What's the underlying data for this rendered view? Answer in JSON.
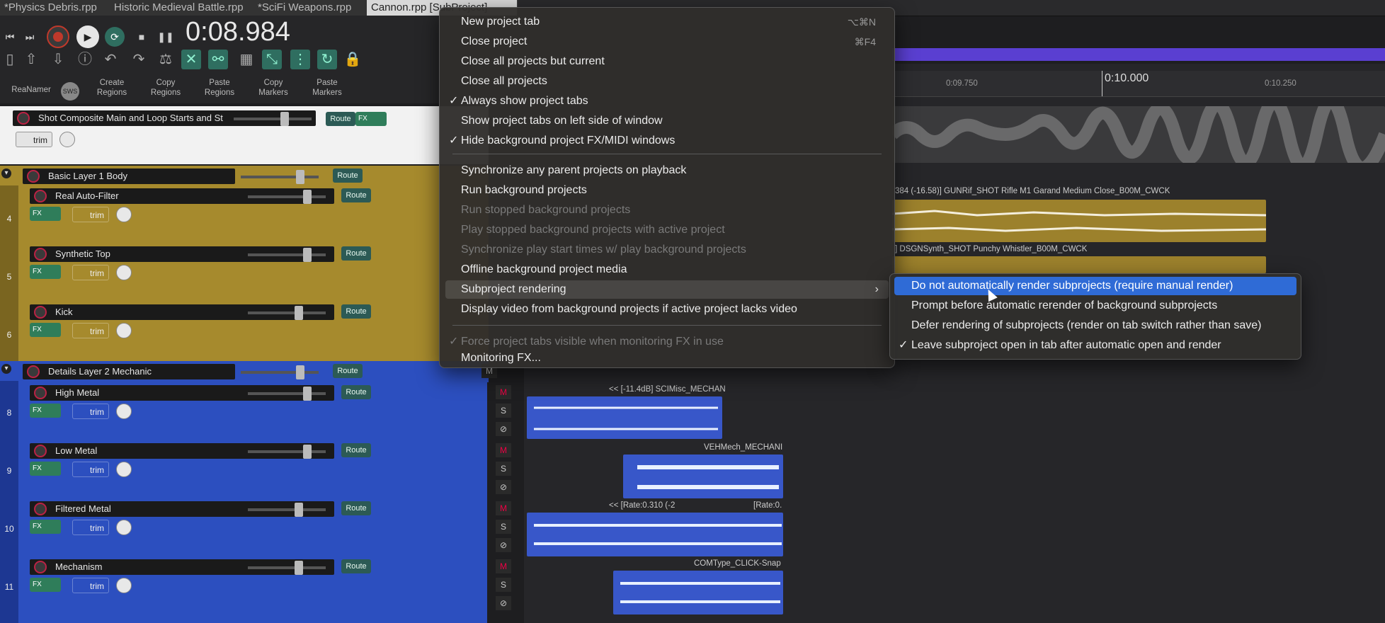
{
  "tabs": [
    "*Physics Debris.rpp",
    "Historic Medieval Battle.rpp",
    "*SciFi Weapons.rpp",
    "Cannon.rpp [SubProject]"
  ],
  "transport": {
    "timecode": "0:08.984"
  },
  "toolbar": {
    "labels": [
      "ReaNamer",
      "Create\nRegions",
      "Copy\nRegions",
      "Paste\nRegions",
      "Copy\nMarkers",
      "Paste\nMarkers"
    ],
    "badge": "SWS"
  },
  "tracks": [
    {
      "num": "",
      "name": "Shot Composite Main and Loop Starts and St",
      "color": "#ffffff",
      "route": "Route",
      "fx": "FX",
      "trim": "trim"
    },
    {
      "num": "",
      "name": "Basic Layer 1 Body",
      "color": "#a68a2d",
      "route": "Route"
    },
    {
      "num": "4",
      "name": "Real Auto-Filter",
      "color": "#a68a2d",
      "route": "Route",
      "fx": "FX",
      "trim": "trim"
    },
    {
      "num": "5",
      "name": "Synthetic Top",
      "color": "#a68a2d",
      "route": "Route",
      "fx": "FX",
      "trim": "trim"
    },
    {
      "num": "6",
      "name": "Kick",
      "color": "#a68a2d",
      "route": "Route",
      "fx": "FX",
      "trim": "trim"
    },
    {
      "num": "",
      "name": "Details Layer 2 Mechanic",
      "color": "#2c4fbf",
      "route": "Route"
    },
    {
      "num": "8",
      "name": "High Metal",
      "color": "#2c4fbf",
      "route": "Route",
      "fx": "FX",
      "trim": "trim"
    },
    {
      "num": "9",
      "name": "Low Metal",
      "color": "#2c4fbf",
      "route": "Route",
      "fx": "FX",
      "trim": "trim"
    },
    {
      "num": "10",
      "name": "Filtered Metal",
      "color": "#2c4fbf",
      "route": "Route",
      "fx": "FX",
      "trim": "trim"
    },
    {
      "num": "11",
      "name": "Mechanism",
      "color": "#2c4fbf",
      "route": "Route",
      "fx": "FX",
      "trim": "trim"
    }
  ],
  "ms_labels": {
    "m": "M",
    "s": "S"
  },
  "ruler": {
    "t1": "0:09.750",
    "t2": "0:10.000",
    "t3": "0:10.250"
  },
  "clips": {
    "c1": "384 (-16.58)] GUNRif_SHOT Rifle M1 Garand Medium Close_B00M_CWCK",
    "c2": "] DSGNSynth_SHOT Punchy Whistler_B00M_CWCK",
    "c3": "<< [-11.4dB] SCIMisc_MECHAN",
    "c4": "VEHMech_MECHANI",
    "c5": "<< [Rate:0.310 (-2",
    "c6": "[Rate:0.",
    "c7": "COMType_CLICK-Snap"
  },
  "menu": {
    "items": [
      {
        "label": "New project tab",
        "shortcut": "⌥⌘N",
        "checked": false,
        "disabled": false
      },
      {
        "label": "Close project",
        "shortcut": "⌘F4",
        "checked": false,
        "disabled": false
      },
      {
        "label": "Close all projects but current",
        "shortcut": "",
        "checked": false,
        "disabled": false
      },
      {
        "label": "Close all projects",
        "shortcut": "",
        "checked": false,
        "disabled": false
      },
      {
        "label": "Always show project tabs",
        "shortcut": "",
        "checked": true,
        "disabled": false
      },
      {
        "label": "Show project tabs on left side of window",
        "shortcut": "",
        "checked": false,
        "disabled": false
      },
      {
        "label": "Hide background project FX/MIDI windows",
        "shortcut": "",
        "checked": true,
        "disabled": false
      },
      {
        "label": "Synchronize any parent projects on playback",
        "shortcut": "",
        "checked": false,
        "disabled": false
      },
      {
        "label": "Run background projects",
        "shortcut": "",
        "checked": false,
        "disabled": false
      },
      {
        "label": "Run stopped background projects",
        "shortcut": "",
        "checked": false,
        "disabled": true
      },
      {
        "label": "Play stopped background projects with active project",
        "shortcut": "",
        "checked": false,
        "disabled": true
      },
      {
        "label": "Synchronize play start times w/ play background projects",
        "shortcut": "",
        "checked": false,
        "disabled": true
      },
      {
        "label": "Offline background project media",
        "shortcut": "",
        "checked": false,
        "disabled": false
      },
      {
        "label": "Subproject rendering",
        "shortcut": "",
        "checked": false,
        "disabled": false,
        "submenu": true
      },
      {
        "label": "Display video from background projects if active project lacks video",
        "shortcut": "",
        "checked": false,
        "disabled": false
      },
      {
        "label": "Force project tabs visible when monitoring FX in use",
        "shortcut": "",
        "checked": true,
        "disabled": true
      },
      {
        "label": "Monitoring FX...",
        "shortcut": "",
        "checked": false,
        "disabled": false
      }
    ]
  },
  "submenu": {
    "items": [
      {
        "label": "Do not automatically render subprojects (require manual render)",
        "checked": false,
        "selected": true
      },
      {
        "label": "Prompt before automatic rerender of background subprojects",
        "checked": false,
        "selected": false
      },
      {
        "label": "Defer rendering of subprojects (render on tab switch rather than save)",
        "checked": false,
        "selected": false
      },
      {
        "label": "Leave subproject open in tab after automatic open and render",
        "checked": true,
        "selected": false
      }
    ]
  },
  "colors": {
    "accent": "#2f6bd6",
    "gold": "#a68a2d",
    "blue": "#2c4fbf",
    "purple": "#5a3fd1"
  }
}
